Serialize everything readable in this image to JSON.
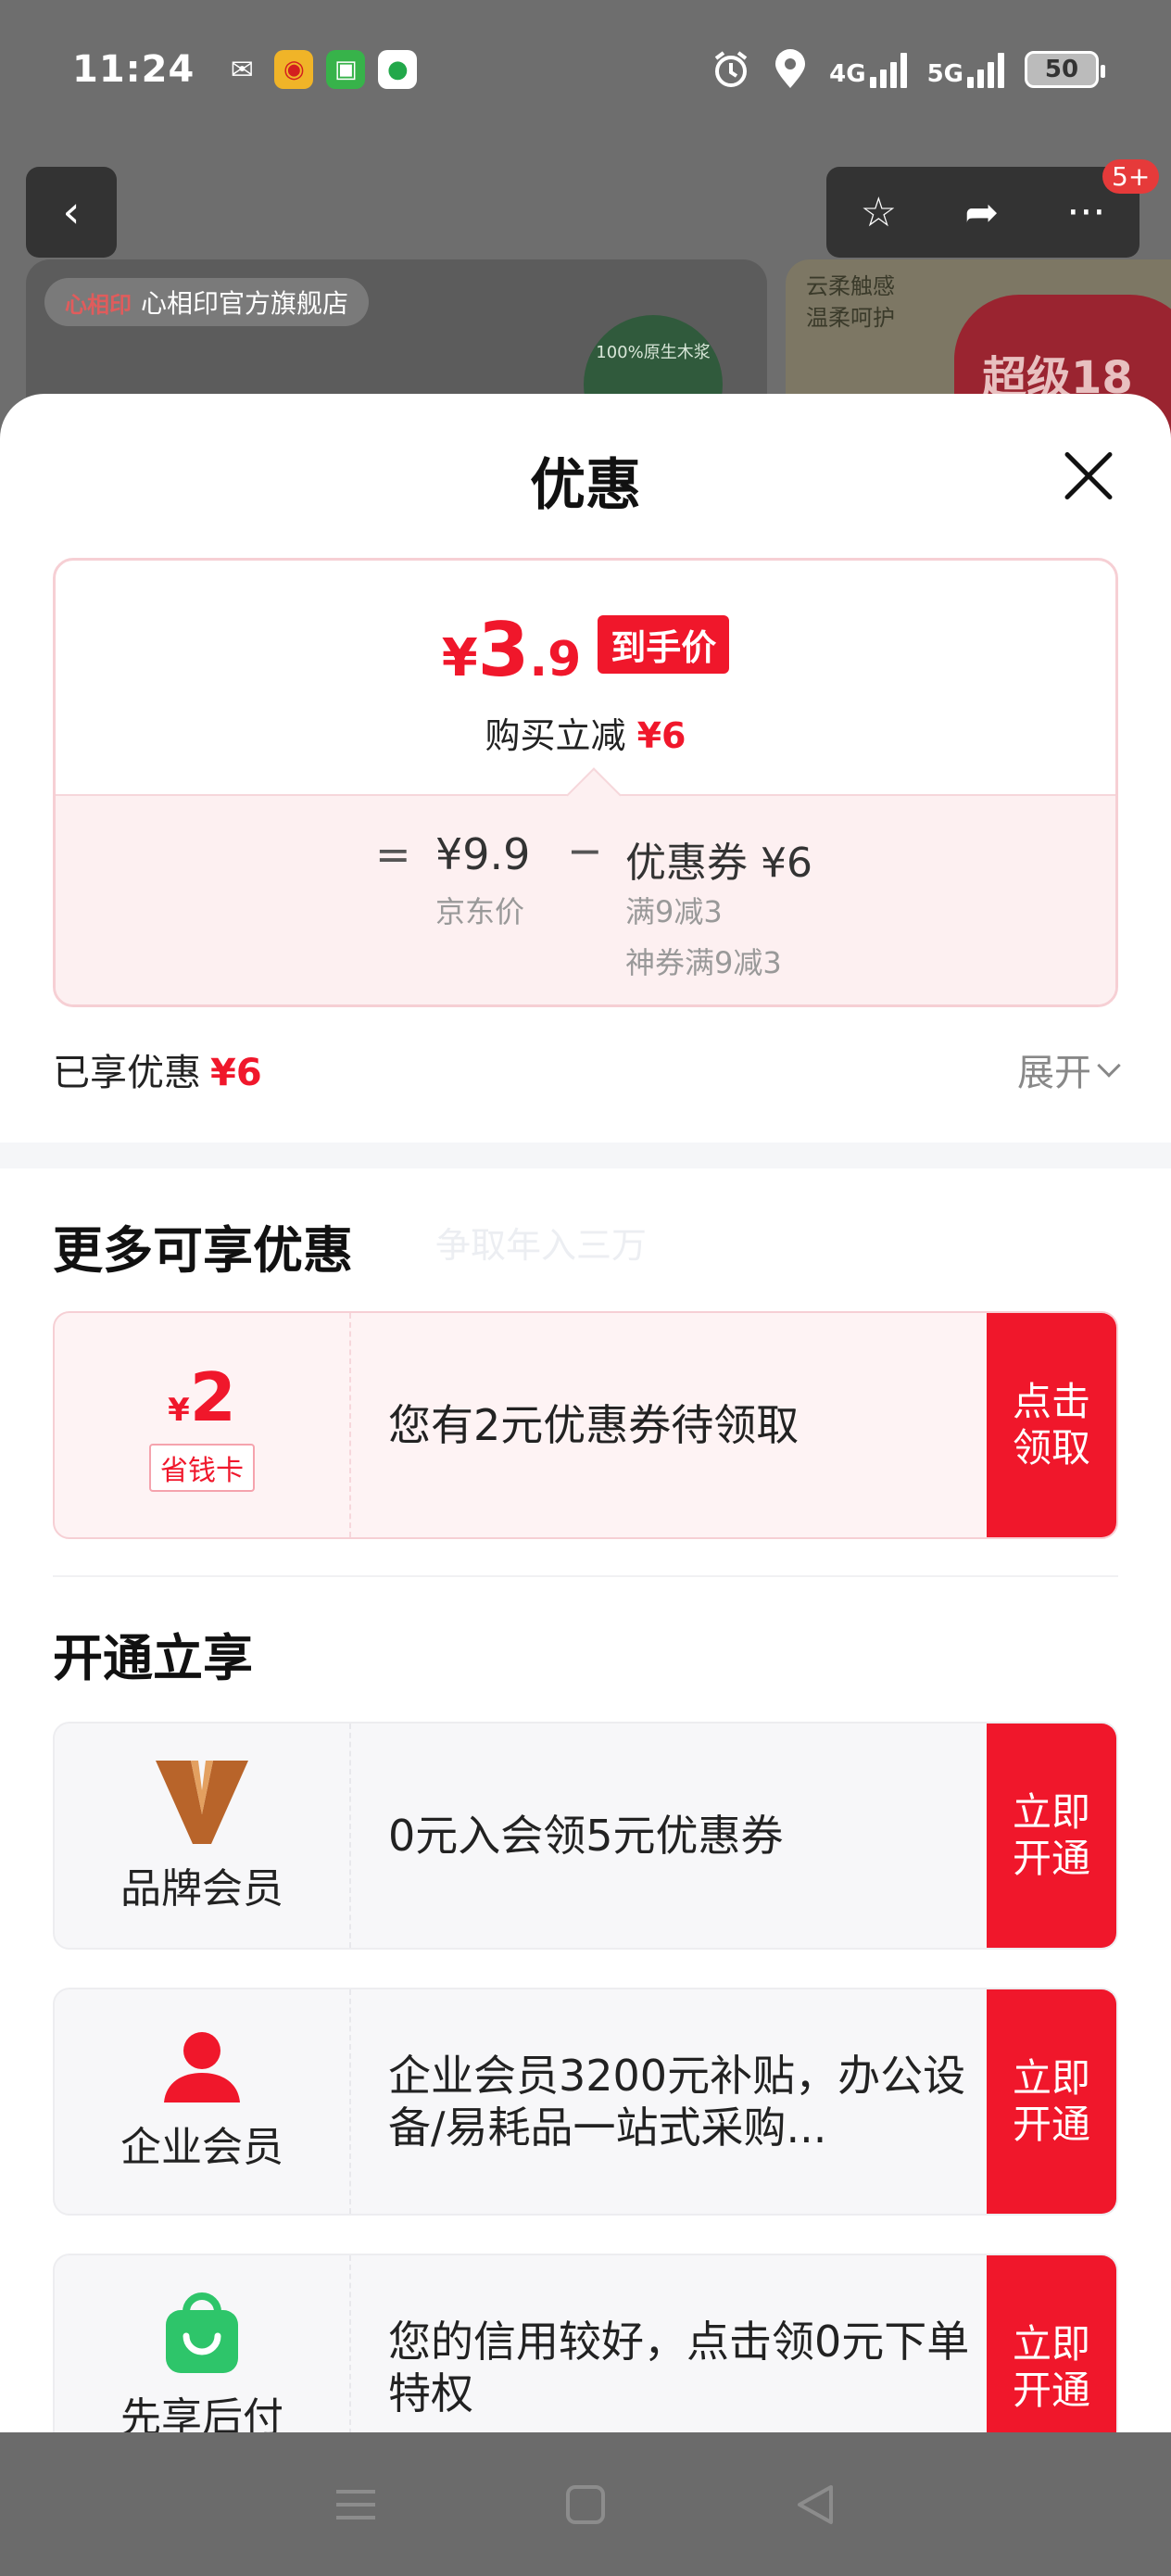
{
  "status": {
    "time": "11:24",
    "signal_4g": "4G",
    "signal_5g": "5G",
    "battery": "50",
    "apps": [
      "wechat-icon",
      "weibo-icon",
      "green-app-icon",
      "message-app-icon"
    ]
  },
  "background": {
    "notification_badge": "5+",
    "store_name": "心相印官方旗舰店",
    "store_logo": "心相印",
    "seal_text": "100%原生木浆",
    "promo_line1": "云柔触感",
    "promo_line2": "温柔呵护",
    "promo_banner": "超级18"
  },
  "sheet": {
    "title": "优惠",
    "final_price": {
      "currency": "¥",
      "integer": "3",
      "decimal": ".9",
      "badge": "到手价"
    },
    "instant_discount_label": "购买立减",
    "instant_discount_value": "¥6",
    "breakdown": {
      "equals": "=",
      "jd_price": "¥9.9",
      "jd_price_label": "京东价",
      "minus": "−",
      "coupon": "优惠券 ¥6",
      "coupon_line1": "满9减3",
      "coupon_line2": "神券满9减3"
    },
    "enjoyed_label": "已享优惠",
    "enjoyed_value": "¥6",
    "expand_label": "展开"
  },
  "more_offers": {
    "title": "更多可享优惠",
    "faint_text": "争取年入三万",
    "card": {
      "currency": "¥",
      "amount": "2",
      "tag": "省钱卡",
      "text": "您有2元优惠券待领取",
      "button": "点击领取"
    }
  },
  "open_to_enjoy": {
    "title": "开通立享",
    "items": [
      {
        "label": "品牌会员",
        "text": "0元入会领5元优惠券",
        "button": "立即开通"
      },
      {
        "label": "企业会员",
        "text": "企业会员3200元补贴，办公设备/易耗品一站式采购...",
        "button": "立即开通"
      },
      {
        "label": "先享后付",
        "text": "您的信用较好，点击领0元下单特权",
        "button": "立即开通"
      }
    ]
  },
  "colors": {
    "accent": "#f0172b",
    "brand_gold": "#b8642a",
    "pay_green": "#2ec56a"
  }
}
